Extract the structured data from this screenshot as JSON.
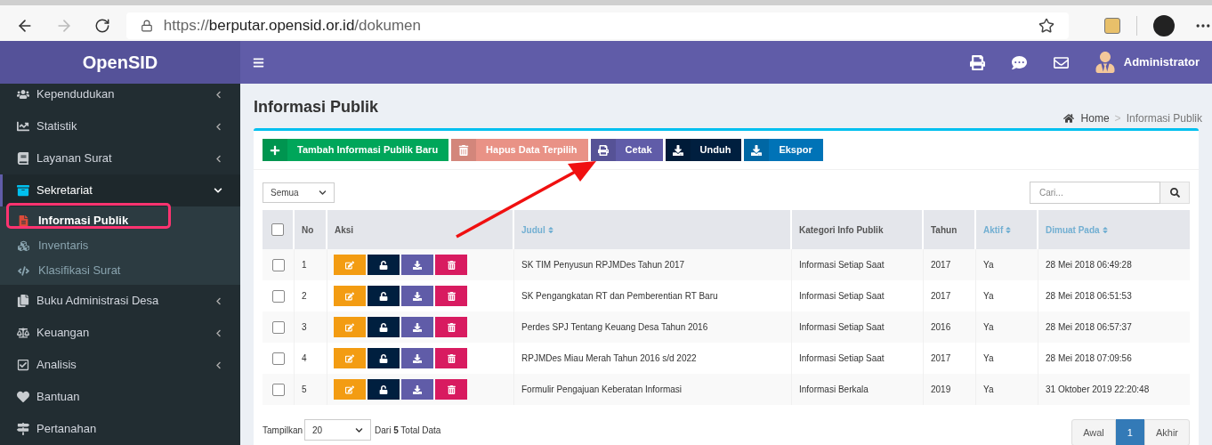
{
  "browser": {
    "url_scheme": "https://",
    "url_host": "berputar.opensid.or.id",
    "url_path": "/dokumen"
  },
  "header": {
    "brand": "OpenSID",
    "user": "Administrator"
  },
  "sidebar": {
    "items": [
      {
        "label": "Kependudukan",
        "kind": "group",
        "expanded": false,
        "selected": false
      },
      {
        "label": "Statistik",
        "kind": "group",
        "expanded": false,
        "selected": false
      },
      {
        "label": "Layanan Surat",
        "kind": "group",
        "expanded": false,
        "selected": false
      },
      {
        "label": "Sekretariat",
        "kind": "group",
        "expanded": true,
        "selected": true,
        "children": [
          {
            "label": "Informasi Publik",
            "selected": true
          },
          {
            "label": "Inventaris",
            "selected": false
          },
          {
            "label": "Klasifikasi Surat",
            "selected": false
          }
        ]
      },
      {
        "label": "Buku Administrasi Desa",
        "kind": "group",
        "expanded": false,
        "selected": false
      },
      {
        "label": "Keuangan",
        "kind": "group",
        "expanded": false,
        "selected": false
      },
      {
        "label": "Analisis",
        "kind": "group",
        "expanded": false,
        "selected": false
      },
      {
        "label": "Bantuan",
        "kind": "link",
        "selected": false
      },
      {
        "label": "Pertanahan",
        "kind": "link",
        "selected": false
      }
    ]
  },
  "page": {
    "title": "Informasi Publik",
    "breadcrumb": [
      "Home",
      "Informasi Publik"
    ],
    "breadcrumb_separator": ">"
  },
  "toolbar": [
    {
      "label": "Tambah Informasi Publik Baru",
      "kind": "add",
      "color": "#00a65a"
    },
    {
      "label": "Hapus Data Terpilih",
      "kind": "delete",
      "color": "#e7877a",
      "disabled": true
    },
    {
      "label": "Cetak",
      "kind": "print",
      "color": "#605ca8"
    },
    {
      "label": "Unduh",
      "kind": "download",
      "color": "#001f3f"
    },
    {
      "label": "Ekspor",
      "kind": "export",
      "color": "#0073b7"
    }
  ],
  "filter": {
    "value": "Semua"
  },
  "search": {
    "placeholder": "Cari..."
  },
  "table": {
    "columns": [
      {
        "label": "No",
        "sortable": false
      },
      {
        "label": "Aksi",
        "sortable": false
      },
      {
        "label": "Judul",
        "sortable": true
      },
      {
        "label": "Kategori Info Publik",
        "sortable": false
      },
      {
        "label": "Tahun",
        "sortable": false
      },
      {
        "label": "Aktif",
        "sortable": true
      },
      {
        "label": "Dimuat Pada",
        "sortable": true
      }
    ],
    "select_all": {
      "checked": false
    },
    "rows": [
      {
        "checked": false,
        "cells": [
          "1",
          "",
          "SK TIM Penyusun RPJMDes Tahun 2017",
          "Informasi Setiap Saat",
          "2017",
          "Ya",
          "28 Mei 2018 06:49:28"
        ]
      },
      {
        "checked": false,
        "cells": [
          "2",
          "",
          "SK Pengangkatan RT dan Pemberentian RT Baru",
          "Informasi Setiap Saat",
          "2017",
          "Ya",
          "28 Mei 2018 06:51:53"
        ]
      },
      {
        "checked": false,
        "cells": [
          "3",
          "",
          "Perdes SPJ Tentang Keuang Desa Tahun 2016",
          "Informasi Setiap Saat",
          "2016",
          "Ya",
          "28 Mei 2018 06:57:37"
        ]
      },
      {
        "checked": false,
        "cells": [
          "4",
          "",
          "RPJMDes Miau Merah Tahun 2016 s/d 2022",
          "Informasi Setiap Saat",
          "2017",
          "Ya",
          "28 Mei 2018 07:09:56"
        ]
      },
      {
        "checked": false,
        "cells": [
          "5",
          "",
          "Formulir Pengajuan Keberatan Informasi",
          "Informasi Berkala",
          "2019",
          "Ya",
          "31 Oktober 2019 22:20:48"
        ]
      }
    ]
  },
  "footer": {
    "show_label": "Tampilkan",
    "page_size": "20",
    "total_text": "Dari **5** Total Data"
  },
  "pagination": [
    {
      "label": "Awal",
      "selected": false
    },
    {
      "label": "1",
      "selected": true
    },
    {
      "label": "Akhir",
      "selected": false
    }
  ]
}
